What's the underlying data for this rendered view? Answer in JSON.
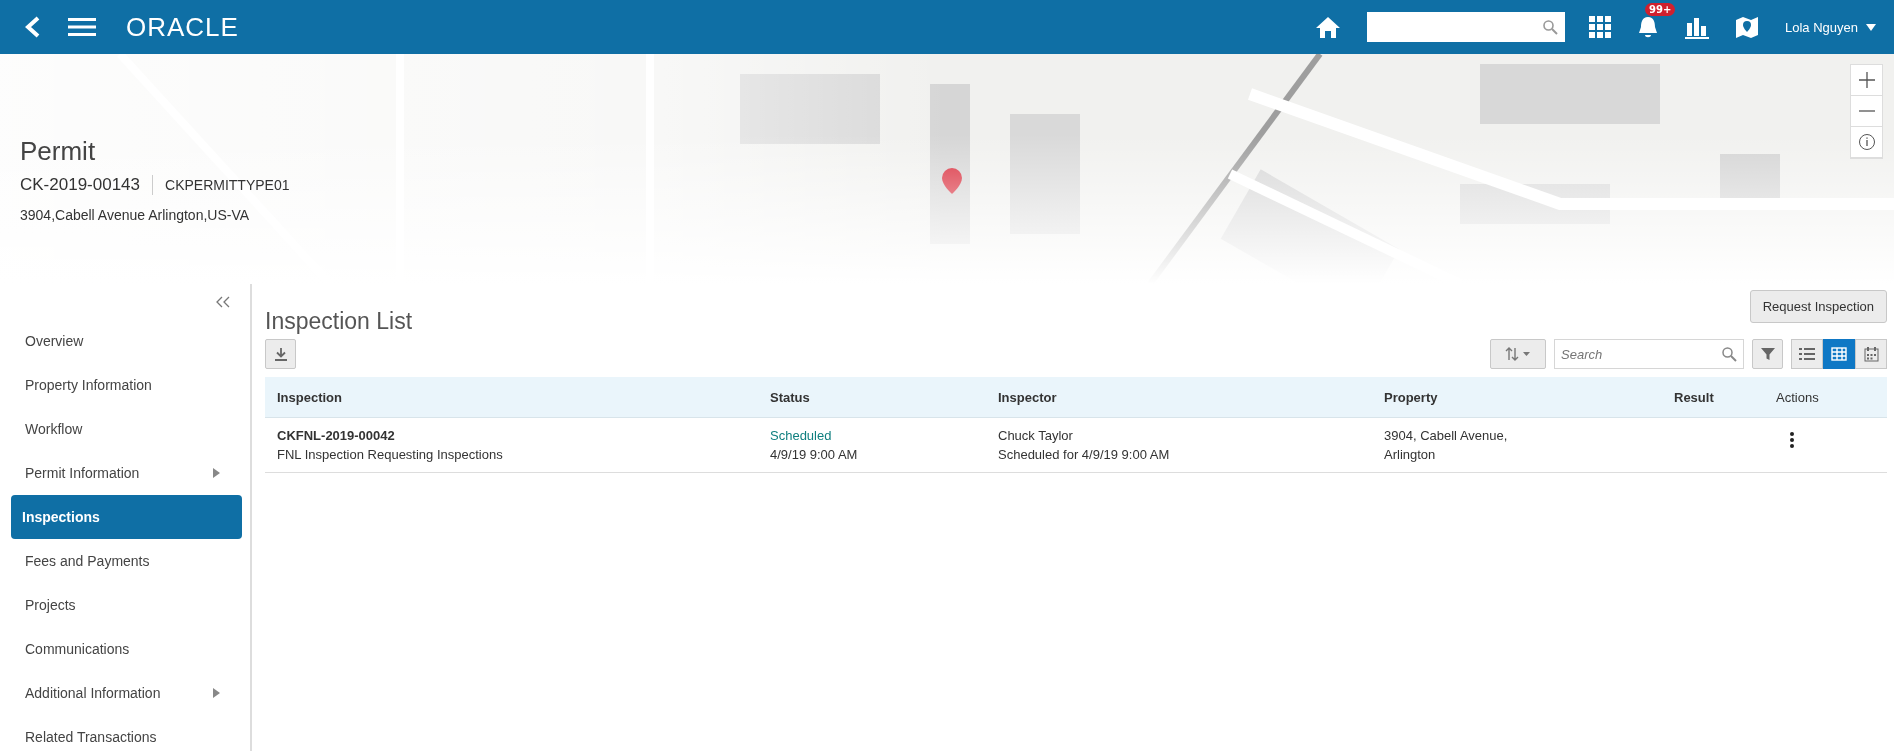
{
  "top_bar": {
    "logo": "ORACLE",
    "notifications_badge": "99+",
    "user": "Lola Nguyen"
  },
  "record": {
    "title": "Permit",
    "number": "CK-2019-00143",
    "type": "CKPERMITTYPE01",
    "address": "3904,Cabell Avenue Arlington,US-VA"
  },
  "sidebar": {
    "items": [
      {
        "label": "Overview",
        "selected": false,
        "has_submenu": false
      },
      {
        "label": "Property Information",
        "selected": false,
        "has_submenu": false
      },
      {
        "label": "Workflow",
        "selected": false,
        "has_submenu": false
      },
      {
        "label": "Permit Information",
        "selected": false,
        "has_submenu": true
      },
      {
        "label": "Inspections",
        "selected": true,
        "has_submenu": false
      },
      {
        "label": "Fees and Payments",
        "selected": false,
        "has_submenu": false
      },
      {
        "label": "Projects",
        "selected": false,
        "has_submenu": false
      },
      {
        "label": "Communications",
        "selected": false,
        "has_submenu": false
      },
      {
        "label": "Additional Information",
        "selected": false,
        "has_submenu": true
      },
      {
        "label": "Related Transactions",
        "selected": false,
        "has_submenu": false
      }
    ]
  },
  "main": {
    "title": "Inspection List",
    "request_button": "Request Inspection",
    "search": {
      "placeholder": "Search"
    },
    "views": [
      {
        "kind": "list",
        "selected": false
      },
      {
        "kind": "table",
        "selected": true
      },
      {
        "kind": "calendar",
        "selected": false
      }
    ],
    "table": {
      "columns": [
        "Inspection",
        "Status",
        "Inspector",
        "Property",
        "Result",
        "Actions"
      ],
      "rows": [
        {
          "inspection": "CKFNL-2019-00042",
          "description": "FNL Inspection Requesting Inspections",
          "status": "Scheduled",
          "status_time": "4/9/19 9:00 AM",
          "inspector": "Chuck Taylor",
          "inspector_note": "Scheduled for 4/9/19 9:00 AM",
          "property_line_1": "3904, Cabell Avenue,",
          "property_line_2": "Arlington"
        }
      ]
    }
  }
}
